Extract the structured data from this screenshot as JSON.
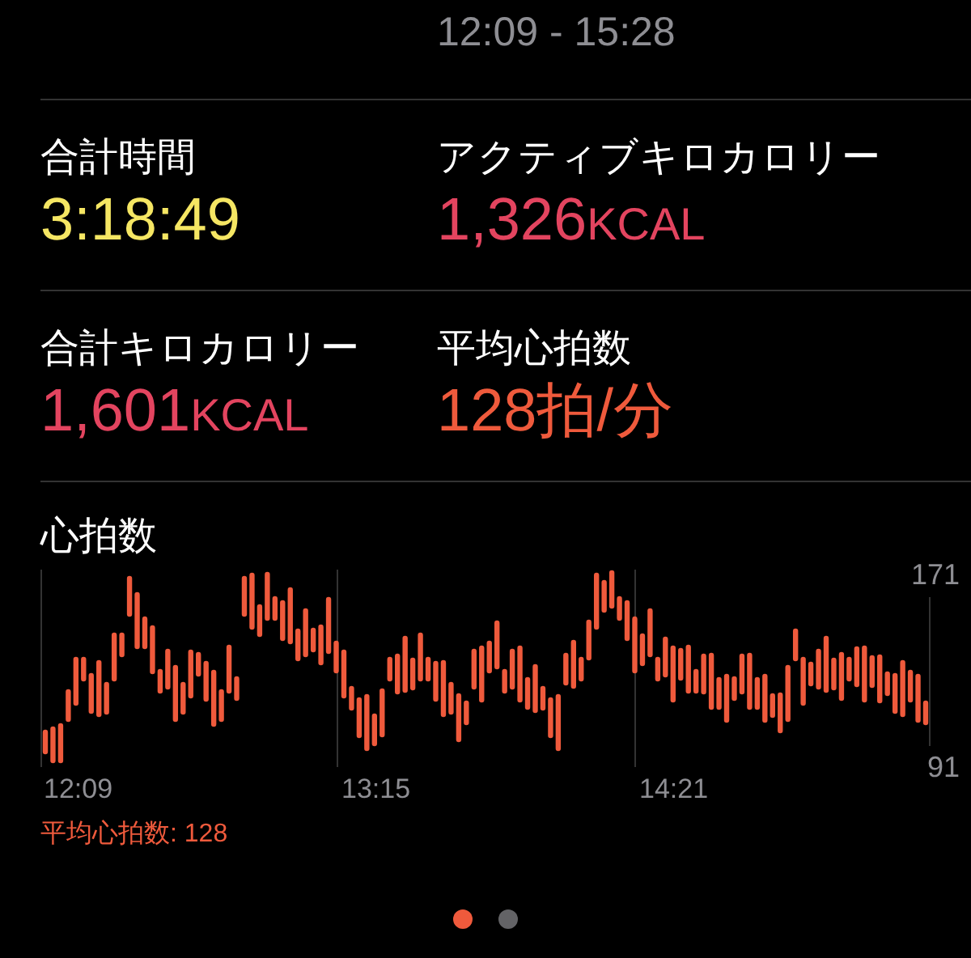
{
  "time_range": "12:09 - 15:28",
  "metrics": [
    {
      "label": "合計時間",
      "value": "3:18:49",
      "color": "#f5e663"
    },
    {
      "label": "アクティブキロカロリー",
      "value": "1,326",
      "unit": "KCAL",
      "color": "#e3445f"
    },
    {
      "label": "合計キロカロリー",
      "value": "1,601",
      "unit": "KCAL",
      "color": "#e3445f"
    },
    {
      "label": "平均心拍数",
      "value": "128拍/分",
      "color": "#ef5a3c"
    }
  ],
  "heart_rate": {
    "title": "心拍数",
    "y_max": "171",
    "y_min": "91",
    "x_labels": [
      "12:09",
      "13:15",
      "14:21"
    ],
    "average": "平均心拍数: 128"
  },
  "pager": [
    {
      "selected": true
    },
    {
      "selected": false
    }
  ]
}
